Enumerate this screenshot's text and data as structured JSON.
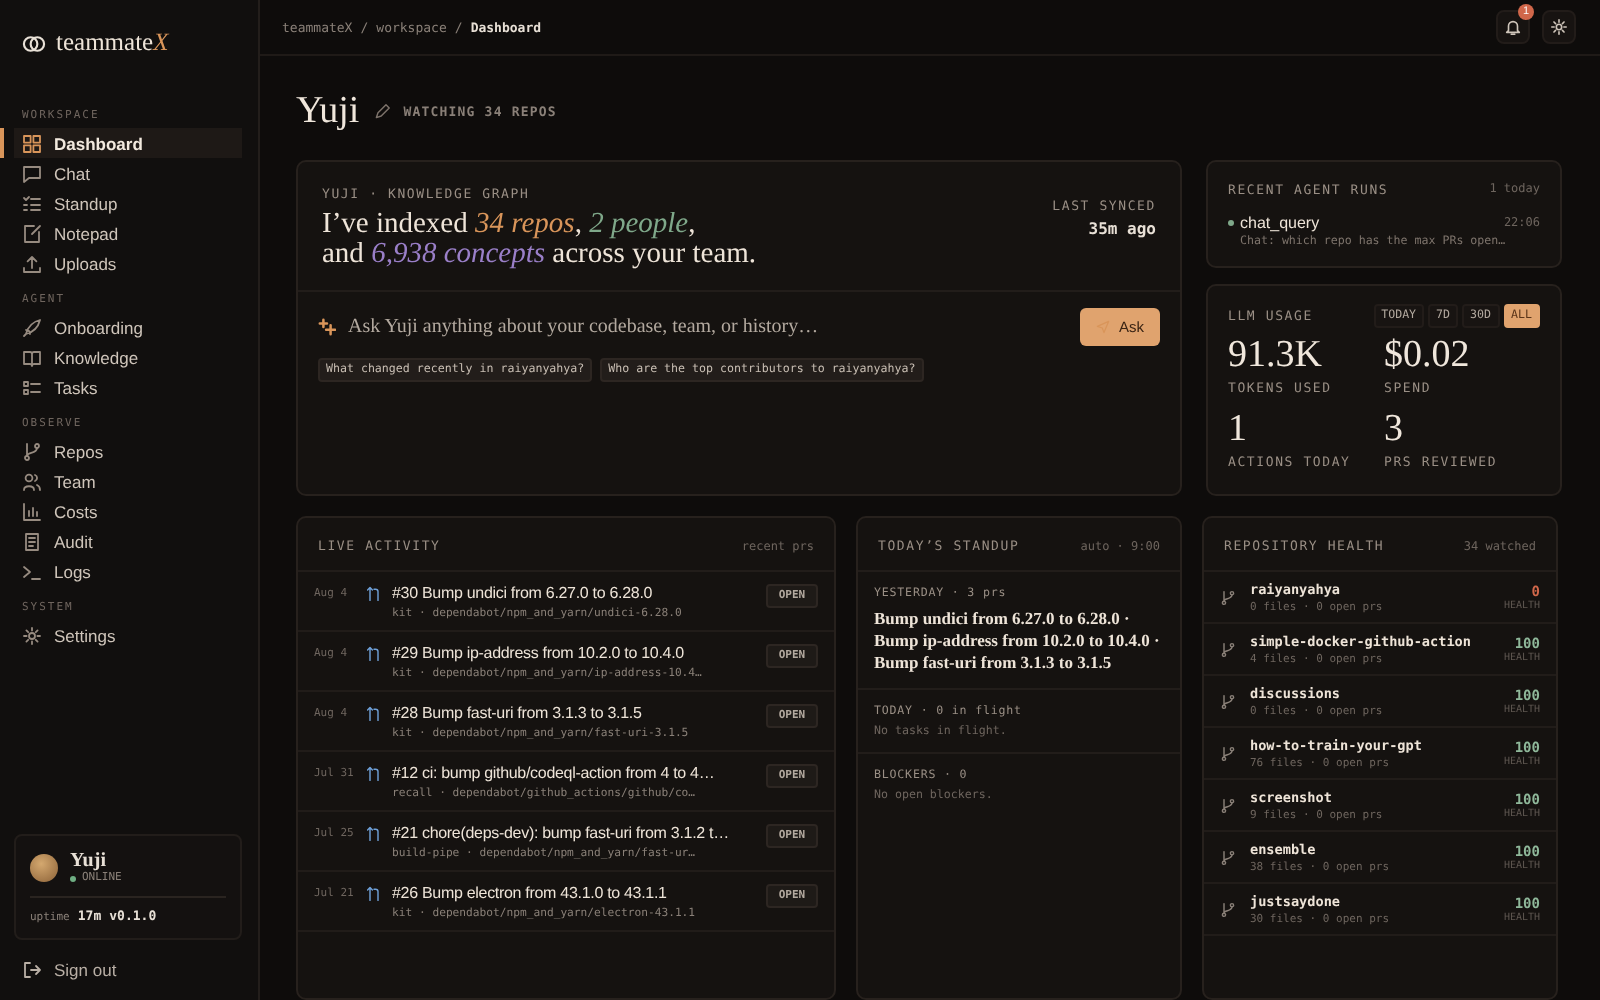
{
  "sidebar": {
    "logo": {
      "text": "teammate",
      "accent": "X"
    },
    "sections": [
      {
        "title": "WORKSPACE",
        "items": [
          {
            "label": "Dashboard",
            "selected": true
          },
          {
            "label": "Chat",
            "selected": false
          },
          {
            "label": "Standup",
            "selected": false
          },
          {
            "label": "Notepad",
            "selected": false
          },
          {
            "label": "Uploads",
            "selected": false
          }
        ]
      },
      {
        "title": "AGENT",
        "items": [
          {
            "label": "Onboarding",
            "selected": false
          },
          {
            "label": "Knowledge",
            "selected": false
          },
          {
            "label": "Tasks",
            "selected": false
          }
        ]
      },
      {
        "title": "OBSERVE",
        "items": [
          {
            "label": "Repos",
            "selected": false
          },
          {
            "label": "Team",
            "selected": false
          },
          {
            "label": "Costs",
            "selected": false
          },
          {
            "label": "Audit",
            "selected": false
          },
          {
            "label": "Logs",
            "selected": false
          }
        ]
      },
      {
        "title": "SYSTEM",
        "items": [
          {
            "label": "Settings",
            "selected": false
          }
        ]
      }
    ],
    "user": {
      "name": "Yuji",
      "status": "ONLINE",
      "uptime_label": "uptime",
      "uptime": "17m",
      "version": "v0.1.0"
    },
    "sign_out": "Sign out"
  },
  "topbar": {
    "breadcrumbs": [
      "teammateX",
      "workspace",
      "Dashboard"
    ],
    "separator": "/",
    "notification_count": "1"
  },
  "header": {
    "title": "Yuji",
    "subtitle": "WATCHING 34 REPOS"
  },
  "hero": {
    "eyebrow": "YUJI · KNOWLEDGE GRAPH",
    "headline": [
      [
        {
          "text": "I’ve indexed "
        },
        {
          "text": "34 repos",
          "color": "#d9955a"
        },
        {
          "text": ", "
        },
        {
          "text": "2 people",
          "color": "#7fa88a"
        },
        {
          "text": ","
        }
      ],
      [
        {
          "text": "and "
        },
        {
          "text": "6,938 concepts",
          "color": "#9a7fc8"
        },
        {
          "text": " across your team."
        }
      ]
    ],
    "last_synced_label": "LAST SYNCED",
    "last_synced": "35m ago",
    "ask": {
      "placeholder": "Ask Yuji anything about your codebase, team, or history…",
      "button": "Ask"
    },
    "suggestions": [
      "What changed recently in raiyanyahya?",
      "Who are the top contributors to raiyanyahya?"
    ]
  },
  "recent_runs": {
    "title": "RECENT AGENT RUNS",
    "count": "1 today",
    "runs": [
      {
        "name": "chat_query",
        "time": "22:06",
        "detail": "Chat: which repo has the max PRs open…",
        "color": "#7fa88a"
      }
    ]
  },
  "llm_usage": {
    "title": "LLM USAGE",
    "ranges": [
      {
        "label": "TODAY",
        "selected": false
      },
      {
        "label": "7D",
        "selected": false
      },
      {
        "label": "30D",
        "selected": false
      },
      {
        "label": "ALL",
        "selected": true
      }
    ],
    "stats": [
      {
        "value": "91.3K",
        "label": "TOKENS USED"
      },
      {
        "value": "$0.02",
        "label": "SPEND"
      },
      {
        "value": "1",
        "label": "ACTIONS TODAY"
      },
      {
        "value": "3",
        "label": "PRS REVIEWED"
      }
    ]
  },
  "live_activity": {
    "title": "LIVE ACTIVITY",
    "note": "recent prs",
    "items": [
      {
        "date": "Aug 4",
        "title": "#30 Bump undici from 6.27.0 to 6.28.0",
        "meta": "kit · dependabot/npm_and_yarn/undici-6.28.0",
        "status": "OPEN"
      },
      {
        "date": "Aug 4",
        "title": "#29 Bump ip-address from 10.2.0 to 10.4.0",
        "meta": "kit · dependabot/npm_and_yarn/ip-address-10.4…",
        "status": "OPEN"
      },
      {
        "date": "Aug 4",
        "title": "#28 Bump fast-uri from 3.1.3 to 3.1.5",
        "meta": "kit · dependabot/npm_and_yarn/fast-uri-3.1.5",
        "status": "OPEN"
      },
      {
        "date": "Jul 31",
        "title": "#12 ci: bump github/codeql-action from 4 to 4…",
        "meta": "recall · dependabot/github_actions/github/co…",
        "status": "OPEN"
      },
      {
        "date": "Jul 25",
        "title": "#21 chore(deps-dev): bump fast-uri from 3.1.2 t…",
        "meta": "build-pipe · dependabot/npm_and_yarn/fast-ur…",
        "status": "OPEN"
      },
      {
        "date": "Jul 21",
        "title": "#26 Bump electron from 43.1.0 to 43.1.1",
        "meta": "kit · dependabot/npm_and_yarn/electron-43.1.1",
        "status": "OPEN"
      }
    ]
  },
  "standup": {
    "title": "TODAY’S STANDUP",
    "note": "auto · 9:00",
    "sections": [
      {
        "kind": "summary",
        "title": "YESTERDAY · 3 prs",
        "body": "Bump undici from 6.27.0 to 6.28.0 · Bump ip-address from 10.2.0 to 10.4.0 · Bump fast-uri from 3.1.3 to 3.1.5"
      },
      {
        "kind": "empty",
        "title": "TODAY · 0 in flight",
        "body": "No tasks in flight."
      },
      {
        "kind": "empty",
        "title": "BLOCKERS · 0",
        "body": "No open blockers."
      }
    ]
  },
  "repo_health": {
    "title": "REPOSITORY HEALTH",
    "note": "34 watched",
    "repos": [
      {
        "name": "raiyanyahya",
        "meta": "0 files · 0 open prs",
        "score": "0",
        "score_label": "HEALTH",
        "color": "#d0674a"
      },
      {
        "name": "simple-docker-github-action",
        "meta": "4 files · 0 open prs",
        "score": "100",
        "score_label": "HEALTH",
        "color": "#8fb89a"
      },
      {
        "name": "discussions",
        "meta": "0 files · 0 open prs",
        "score": "100",
        "score_label": "HEALTH",
        "color": "#8fb89a"
      },
      {
        "name": "how-to-train-your-gpt",
        "meta": "76 files · 0 open prs",
        "score": "100",
        "score_label": "HEALTH",
        "color": "#8fb89a"
      },
      {
        "name": "screenshot",
        "meta": "9 files · 0 open prs",
        "score": "100",
        "score_label": "HEALTH",
        "color": "#8fb89a"
      },
      {
        "name": "ensemble",
        "meta": "38 files · 0 open prs",
        "score": "100",
        "score_label": "HEALTH",
        "color": "#8fb89a"
      },
      {
        "name": "justsaydone",
        "meta": "30 files · 0 open prs",
        "score": "100",
        "score_label": "HEALTH",
        "color": "#8fb89a"
      }
    ]
  }
}
